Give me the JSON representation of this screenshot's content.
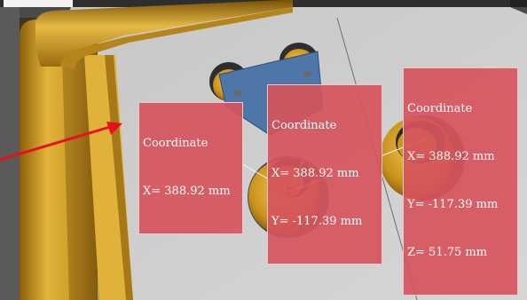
{
  "annotations": [
    {
      "title": "Coordinate",
      "x_line": "X= 388.92 mm"
    },
    {
      "title": "Coordinate",
      "x_line": "X= 388.92 mm",
      "y_line": "Y= -117.39 mm"
    },
    {
      "title": "Coordinate",
      "x_line": "X= 388.92 mm",
      "y_line": "Y= -117.39 mm",
      "z_line": "Z= 51.75 mm"
    }
  ],
  "colors": {
    "annotation_bg": "#d6545c",
    "pointer_arrow": "#e8101a",
    "bracket_gold": "#c9971f",
    "plate_grey": "#cfcfcf",
    "part_blue": "#4f76a8"
  }
}
